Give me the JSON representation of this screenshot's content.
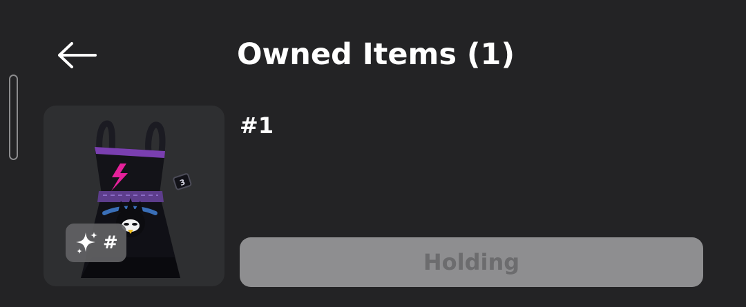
{
  "header": {
    "title": "Owned Items (1)",
    "back_icon": "arrow-left-icon"
  },
  "item": {
    "serial": "#1",
    "badge": {
      "icon": "sparkle-icon",
      "text": "#"
    },
    "action_button": {
      "label": "Holding",
      "enabled": false
    }
  },
  "colors": {
    "background": "#232325",
    "thumbnail_background": "#2e2f31",
    "button_disabled_bg": "#8e8e90",
    "button_disabled_text": "#6c6c6e",
    "accent_pink": "#e6219b",
    "accent_purple": "#8a4fc2"
  }
}
